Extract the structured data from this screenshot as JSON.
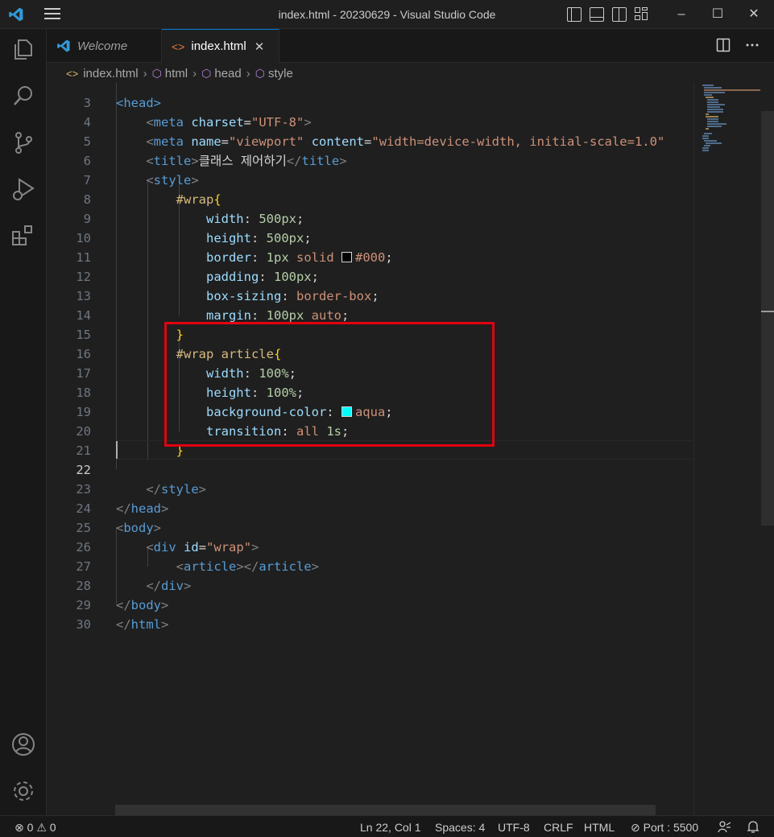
{
  "window": {
    "title": "index.html - 20230629 - Visual Studio Code",
    "minimize": "–",
    "maximize": "☐",
    "close": "✕"
  },
  "tabs": [
    {
      "label": "Welcome",
      "icon": "vscode-logo-icon"
    },
    {
      "label": "index.html",
      "icon": "html-file-icon",
      "close": "✕"
    }
  ],
  "breadcrumb": {
    "file": "index.html",
    "items": [
      "html",
      "head",
      "style"
    ]
  },
  "editor": {
    "top_partial_line": {
      "number": "3",
      "text": "<head>"
    },
    "lines": [
      {
        "n": "4"
      },
      {
        "n": "5"
      },
      {
        "n": "6"
      },
      {
        "n": "7"
      },
      {
        "n": "8"
      },
      {
        "n": "9"
      },
      {
        "n": "10"
      },
      {
        "n": "11"
      },
      {
        "n": "12"
      },
      {
        "n": "13"
      },
      {
        "n": "14"
      },
      {
        "n": "15"
      },
      {
        "n": "16"
      },
      {
        "n": "17"
      },
      {
        "n": "18"
      },
      {
        "n": "19"
      },
      {
        "n": "20"
      },
      {
        "n": "21"
      },
      {
        "n": "22"
      },
      {
        "n": "23"
      },
      {
        "n": "24"
      },
      {
        "n": "25"
      },
      {
        "n": "26"
      },
      {
        "n": "27"
      },
      {
        "n": "28"
      },
      {
        "n": "29"
      },
      {
        "n": "30"
      }
    ],
    "tokens": {
      "meta": "meta",
      "charset_attr": "charset",
      "charset_val": "\"UTF-8\"",
      "name_attr": "name",
      "viewport_val": "\"viewport\"",
      "content_attr": "content",
      "content_val": "\"width=device-width, initial-scale=1.0\"",
      "title_tag": "title",
      "title_text": "클래스 제어하기",
      "style_tag": "style",
      "sel_wrap": "#wrap",
      "sel_wrap_article": "#wrap article",
      "width": "width",
      "height": "height",
      "border": "border",
      "padding": "padding",
      "box_sizing": "box-sizing",
      "margin": "margin",
      "background_color": "background-color",
      "transition": "transition",
      "v500px": "500px",
      "v1px": "1px",
      "solid": "solid",
      "c000": "#000",
      "v100px": "100px",
      "border_box": "border-box",
      "auto": "auto",
      "v100pct": "100%",
      "aqua": "aqua",
      "all": "all",
      "v1s": "1s",
      "head": "head",
      "body": "body",
      "div": "div",
      "id_attr": "id",
      "wrap_val": "\"wrap\"",
      "article": "article",
      "html": "html"
    },
    "colors": {
      "swatch_black": "#000000",
      "swatch_aqua": "#00ffff",
      "highlight": "#e3000f"
    }
  },
  "status": {
    "errors": "0",
    "warnings": "0",
    "position": "Ln 22, Col 1",
    "spaces": "Spaces: 4",
    "encoding": "UTF-8",
    "eol": "CRLF",
    "language": "HTML",
    "port": "Port : 5500"
  }
}
